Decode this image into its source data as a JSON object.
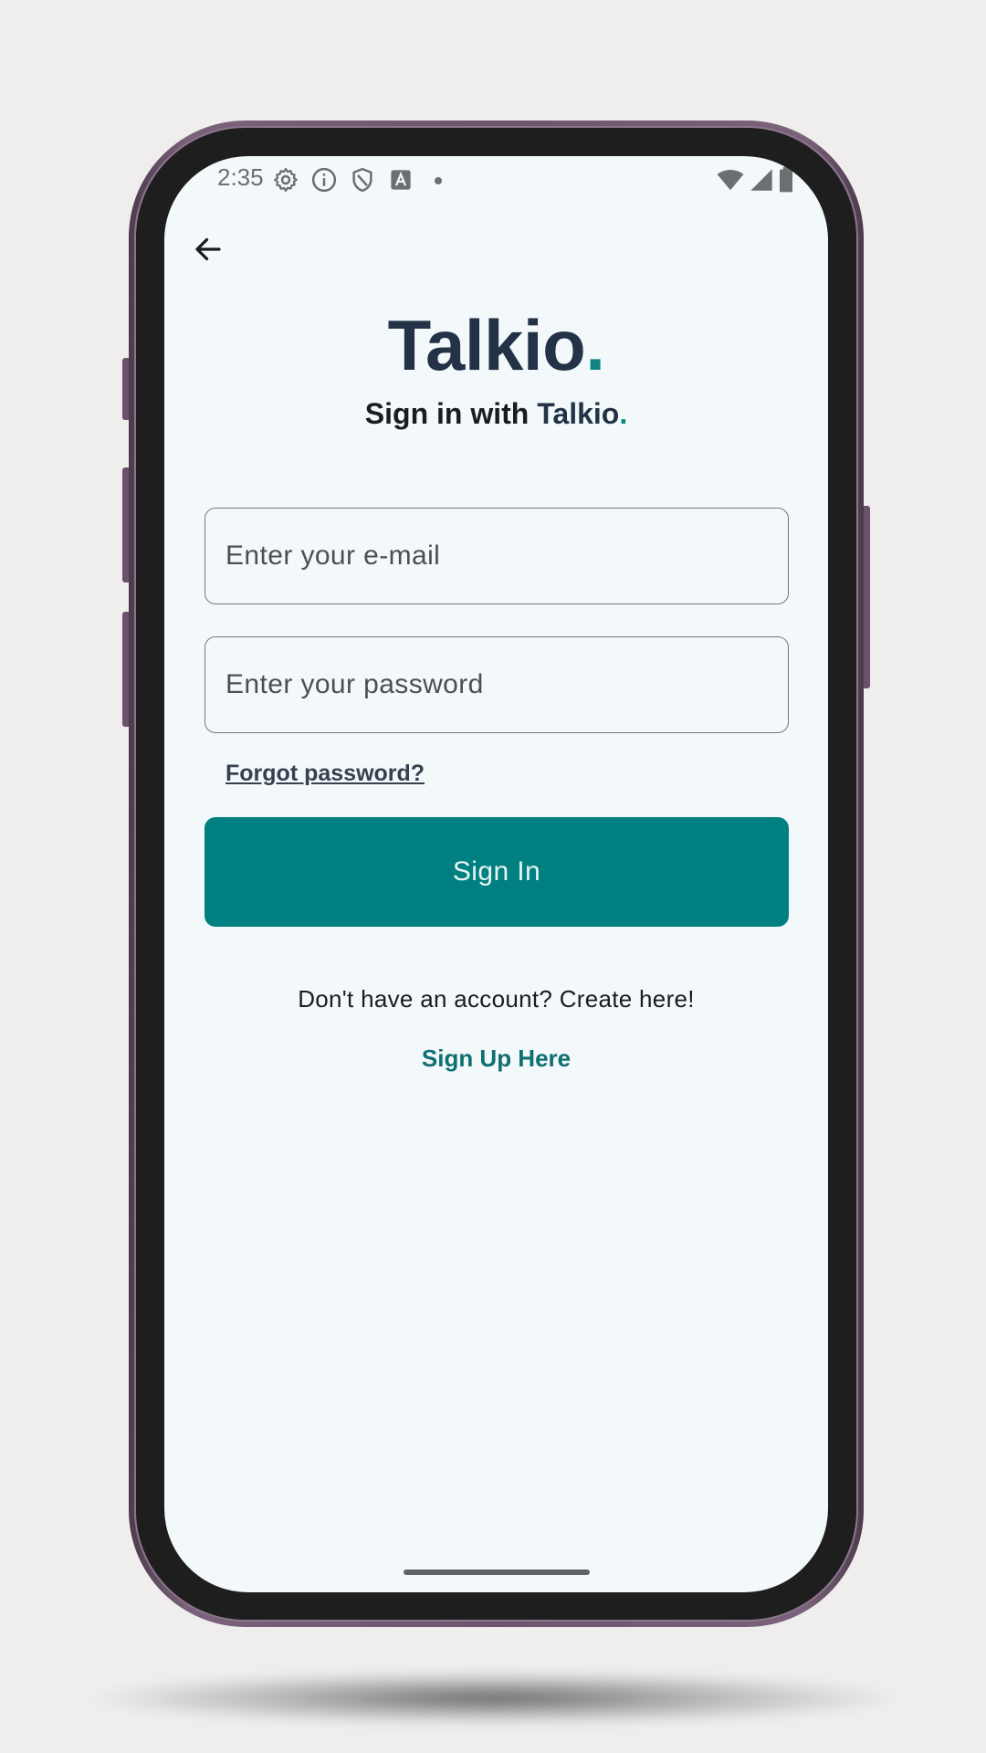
{
  "status_bar": {
    "time": "2:35",
    "left_icons": [
      "gear-icon",
      "info-icon",
      "shield-icon",
      "font-icon"
    ],
    "right_icons": [
      "wifi-icon",
      "signal-icon",
      "battery-icon"
    ]
  },
  "header": {
    "back_icon": "arrow-left-icon",
    "brand": "Talkio",
    "brand_dot": ".",
    "subtitle_prefix": "Sign in with ",
    "subtitle_brand": "Talkio",
    "subtitle_dot": "."
  },
  "form": {
    "email_placeholder": "Enter your e-mail",
    "email_value": "",
    "password_placeholder": "Enter your password",
    "password_value": "",
    "forgot_label": "Forgot password?",
    "signin_label": "Sign In"
  },
  "footer": {
    "no_account_text": "Don't have an account? Create here!",
    "signup_label": "Sign Up Here"
  },
  "colors": {
    "accent": "#008080",
    "brand_text": "#233246",
    "background": "#f3f9fa",
    "link": "#0f6f72"
  }
}
